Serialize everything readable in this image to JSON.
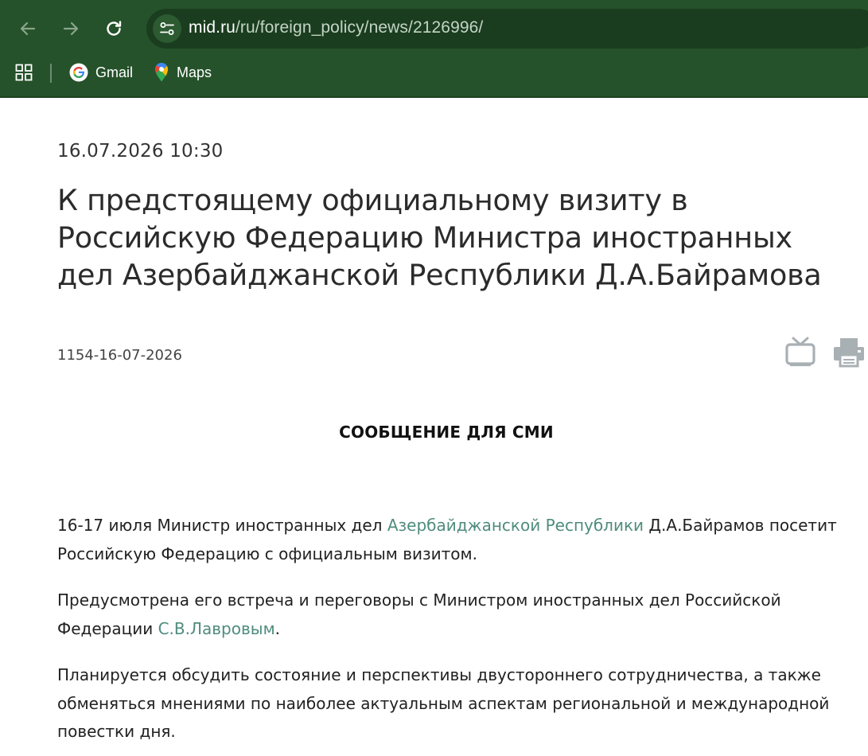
{
  "browser": {
    "url_host": "mid.ru",
    "url_path": "/ru/foreign_policy/news/2126996/",
    "bookmarks": [
      {
        "label": "Gmail",
        "icon": "google-icon"
      },
      {
        "label": "Maps",
        "icon": "maps-pin-icon"
      }
    ]
  },
  "article": {
    "datetime": "16.07.2026 10:30",
    "title": "К предстоящему официальному визиту в Российскую Федерацию Министра иностранных дел Азербайджанской Республики Д.А.Байрамова",
    "number": "1154-16-07-2026",
    "media_heading": "СООБЩЕНИЕ ДЛЯ СМИ",
    "p1": {
      "before": "16-17 июля Министр иностранных дел ",
      "link": "Азербайджанской Республики",
      "after": " Д.А.Байрамов посетит Российскую Федерацию с официальным визитом."
    },
    "p2": {
      "before": "Предусмотрена его встреча и переговоры с Министром иностранных дел Российской Федерации ",
      "link": "С.В.Лавровым",
      "after": "."
    },
    "p3": "Планируется обсудить состояние и перспективы двустороннего сотрудничества, а также обменяться мнениями по наиболее актуальным аспектам региональной и международной повестки дня."
  },
  "colors": {
    "chrome_bg": "#25522a",
    "link": "#4f8c7d",
    "icon_gray": "#a9b0b4"
  }
}
